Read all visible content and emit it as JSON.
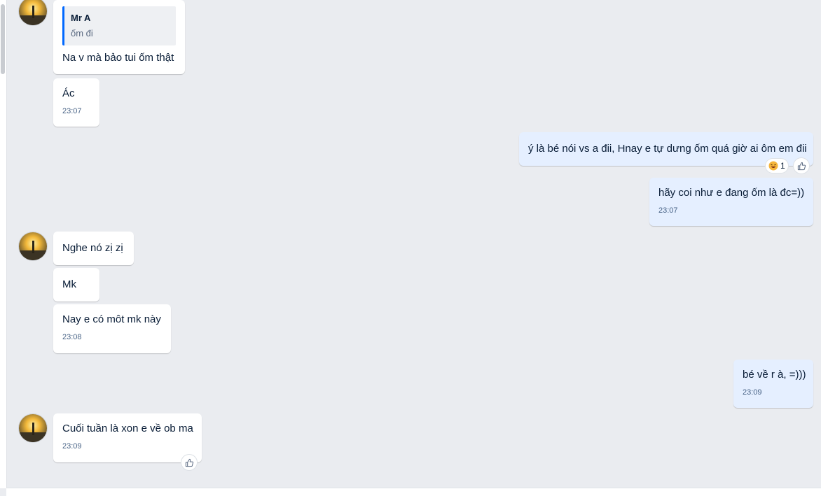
{
  "conversation": {
    "quote": {
      "author": "Mr A",
      "text": "ốm đi"
    },
    "messages": [
      {
        "id": "m1",
        "sender": "contact",
        "text": "Na v mà bảo tui ốm thật"
      },
      {
        "id": "m2",
        "sender": "contact",
        "text": "Ác",
        "time": "23:07"
      },
      {
        "id": "m3",
        "sender": "me",
        "text": "ý là bé nói vs a đii, Hnay e tự dưng ốm quá giờ ai ôm em đii"
      },
      {
        "id": "m4",
        "sender": "me",
        "text": "hãy coi như e đang ốm là đc=))",
        "time": "23:07"
      },
      {
        "id": "m5",
        "sender": "contact",
        "text": "Nghe nó  zị zị"
      },
      {
        "id": "m6",
        "sender": "contact",
        "text": "Mk"
      },
      {
        "id": "m7",
        "sender": "contact",
        "text": "Nay e có môt mk này",
        "time": "23:08"
      },
      {
        "id": "m8",
        "sender": "me",
        "text": "bé về r à, =)))",
        "time": "23:09"
      },
      {
        "id": "m9",
        "sender": "contact",
        "text": "Cuối tuần là xon e về ob ma",
        "time": "23:09"
      }
    ],
    "reactions": {
      "m3": {
        "emoji_icon": "laughing-face-icon",
        "count": "1"
      }
    },
    "colors": {
      "accent": "#0068ff",
      "my_bubble": "#e5efff",
      "their_bubble": "#ffffff",
      "background": "#eaecf0"
    }
  }
}
